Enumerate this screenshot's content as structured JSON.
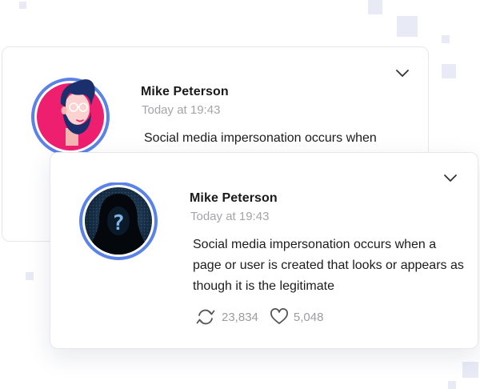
{
  "colors": {
    "accent_ring": "#5b82e6",
    "avatar_pink": "#ef1f6f",
    "avatar_navy": "#1a2f6b",
    "decor": "#e8eaf6"
  },
  "posts": [
    {
      "author": "Mike Peterson",
      "timestamp": "Today at 19:43",
      "text": "Social media impersonation occurs when",
      "avatar_icon": "cartoon-bearded-man-avatar",
      "menu_icon": "chevron-down-icon"
    },
    {
      "author": "Mike Peterson",
      "timestamp": "Today at 19:43",
      "text": "Social media impersonation occurs when a page or user is created that looks or appears as though it is the legitimate",
      "avatar_icon": "hooded-hacker-avatar",
      "menu_icon": "chevron-down-icon",
      "stats": {
        "shares": "23,834",
        "likes": "5,048"
      }
    }
  ]
}
